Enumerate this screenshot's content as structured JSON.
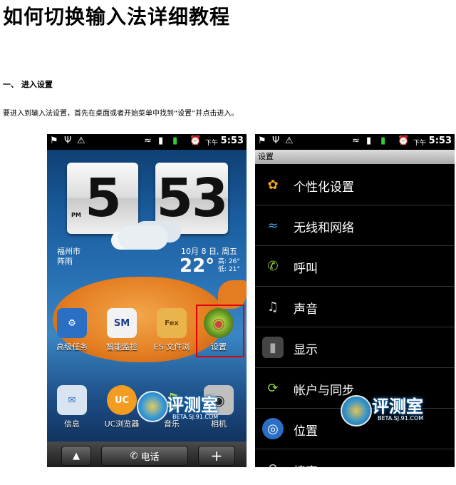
{
  "title": "如何切换输入法详细教程",
  "section_heading": "一、 进入设置",
  "intro": "要进入到输入法设置，首先在桌面或者开始菜单中找到“设置”并点击进入。",
  "status_bar": {
    "ampm": "下午",
    "time": "5:53"
  },
  "home": {
    "clock_hour": "5",
    "clock_minute": "53",
    "clock_pm": "PM",
    "city": "福州市",
    "weather": "阵雨",
    "date": "10月 8 日, 周五",
    "temp": "22°",
    "high": "高: 26°",
    "low": "低: 21°",
    "apps_row1": [
      {
        "label": "高级任务"
      },
      {
        "label": "智能监控"
      },
      {
        "label": "ES 文件浏"
      },
      {
        "label": "设置"
      }
    ],
    "apps_row2": [
      {
        "label": "信息"
      },
      {
        "label": "UC浏览器"
      },
      {
        "label": "音乐"
      },
      {
        "label": "相机"
      }
    ],
    "dock_call": "电话",
    "dock_plus": "+"
  },
  "settings": {
    "header": "设置",
    "items": [
      {
        "label": "个性化设置",
        "icon": "personalize-icon"
      },
      {
        "label": "无线和网络",
        "icon": "wireless-icon"
      },
      {
        "label": "呼叫",
        "icon": "phone-icon"
      },
      {
        "label": "声音",
        "icon": "speaker-icon"
      },
      {
        "label": "显示",
        "icon": "display-icon"
      },
      {
        "label": "帐户与同步",
        "icon": "sync-icon"
      },
      {
        "label": "位置",
        "icon": "location-icon"
      },
      {
        "label": "搜索",
        "icon": "search-icon"
      }
    ]
  },
  "watermark": {
    "text": "评测室",
    "sub": "BETA.SJ.91.COM"
  }
}
